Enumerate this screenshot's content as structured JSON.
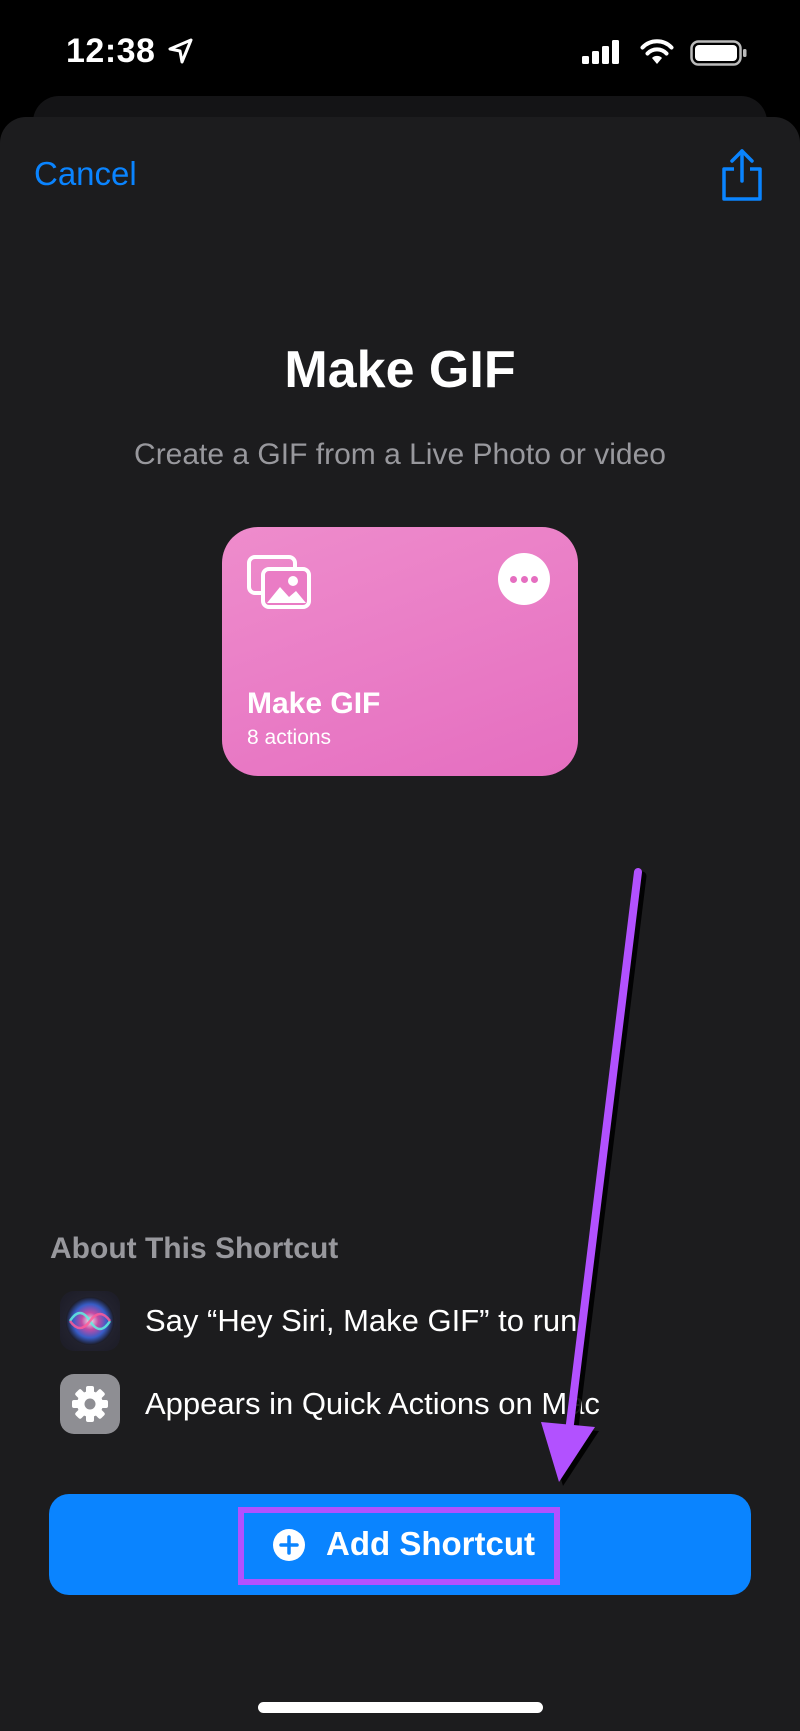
{
  "status_bar": {
    "time": "12:38"
  },
  "header": {
    "cancel_label": "Cancel"
  },
  "shortcut": {
    "title": "Make GIF",
    "subtitle": "Create a GIF from a Live Photo or video",
    "card": {
      "name": "Make GIF",
      "actions": "8 actions",
      "color": "#e56ec0"
    }
  },
  "about": {
    "heading": "About This Shortcut",
    "items": [
      {
        "icon": "siri-icon",
        "label": "Say “Hey Siri, Make GIF” to run"
      },
      {
        "icon": "gear-icon",
        "label": "Appears in Quick Actions on Mac"
      }
    ]
  },
  "add_button": {
    "label": "Add Shortcut",
    "color": "#0a84ff"
  },
  "annotation": {
    "color": "#b251ff"
  }
}
